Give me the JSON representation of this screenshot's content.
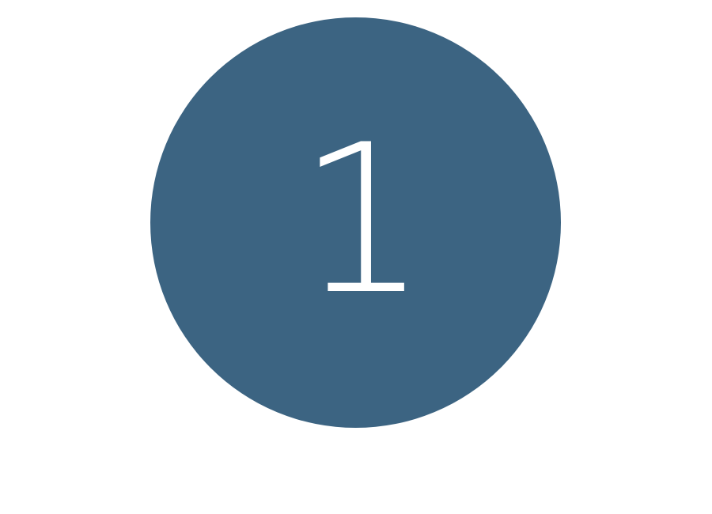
{
  "step": {
    "number": "1",
    "circle_color": "#3c6482",
    "text_color": "#ffffff"
  }
}
